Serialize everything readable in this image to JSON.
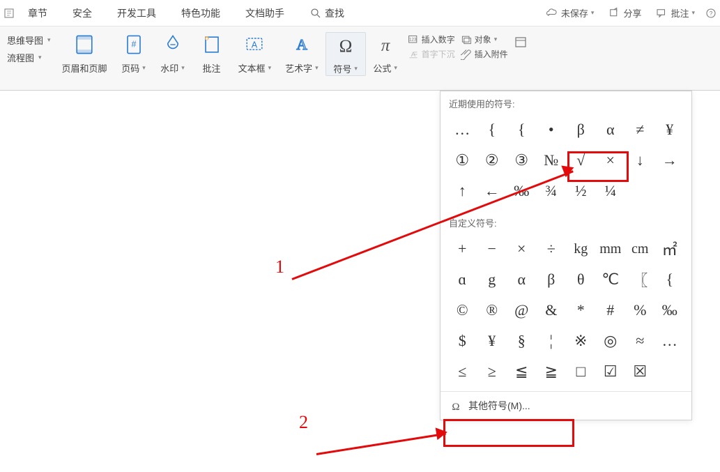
{
  "menu": {
    "items": [
      "章节",
      "安全",
      "开发工具",
      "特色功能",
      "文档助手"
    ],
    "find": "查找",
    "right": {
      "unsaved": "未保存",
      "share": "分享",
      "comment": "批注"
    }
  },
  "toolbar": {
    "left_small": {
      "mindmap": "思维导图",
      "flowchart": "流程图"
    },
    "header_footer": "页眉和页脚",
    "page_number": "页码",
    "watermark": "水印",
    "comment": "批注",
    "textbox": "文本框",
    "wordart": "艺术字",
    "symbol": "符号",
    "equation": "公式",
    "side": {
      "insert_number": "插入数字",
      "object": "对象",
      "dropcap": "首字下沉",
      "attachment": "插入附件"
    }
  },
  "panel": {
    "recent_label": "近期使用的符号:",
    "custom_label": "自定义符号:",
    "more": "其他符号(M)...",
    "recent": [
      "…",
      "{",
      "{",
      "•",
      "β",
      "α",
      "≠",
      "¥",
      "①",
      "②",
      "③",
      "№",
      "√",
      "×",
      "↓",
      "→",
      "↑",
      "←",
      "‰",
      "¾",
      "½",
      "¼",
      "",
      ""
    ],
    "custom": [
      "+",
      "−",
      "×",
      "÷",
      "kg",
      "mm",
      "cm",
      "㎡",
      "ɑ",
      "g",
      "α",
      "β",
      "θ",
      "℃",
      "〖",
      "{",
      "©",
      "®",
      "@",
      "&",
      "*",
      "#",
      "%",
      "‰",
      "$",
      "¥",
      "§",
      "¦",
      "※",
      "◎",
      "≈",
      "…",
      "≤",
      "≥",
      "≦",
      "≧",
      "□",
      "☑",
      "☒",
      ""
    ]
  },
  "annotations": {
    "one": "1",
    "two": "2"
  }
}
